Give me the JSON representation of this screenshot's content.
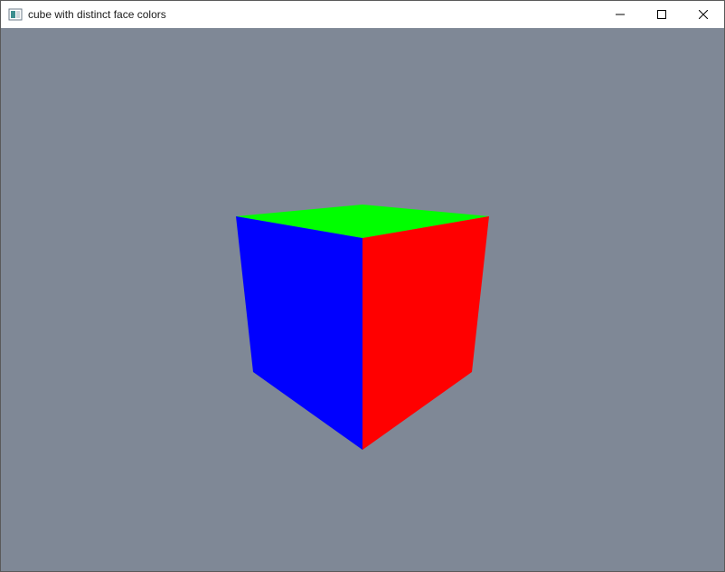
{
  "window": {
    "title": "cube with distinct face colors",
    "controls": {
      "minimize_icon": "minimize-icon",
      "maximize_icon": "maximize-icon",
      "close_icon": "close-icon"
    }
  },
  "scene": {
    "background_color": "#7f8896",
    "faces": {
      "top": "#00ff00",
      "left": "#0000ff",
      "right": "#ff0000"
    }
  }
}
